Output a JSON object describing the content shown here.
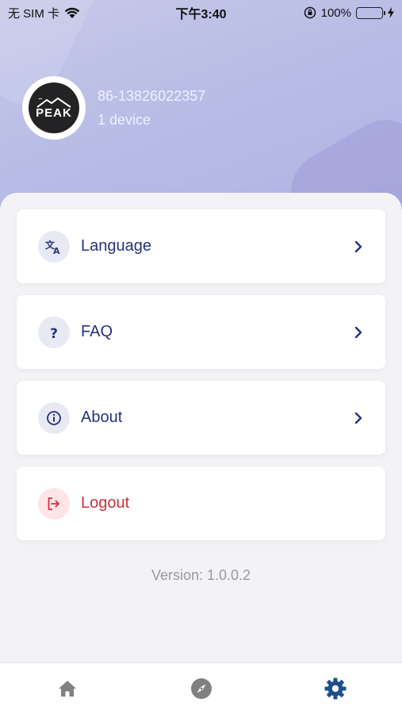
{
  "status_bar": {
    "carrier": "无 SIM 卡",
    "time": "下午3:40",
    "battery": "100%"
  },
  "profile": {
    "avatar_text": "PEAK",
    "phone": "86-13826022357",
    "devices": "1 device"
  },
  "menu": {
    "items": [
      {
        "label": "Language",
        "icon": "translate-icon"
      },
      {
        "label": "FAQ",
        "icon": "question-icon"
      },
      {
        "label": "About",
        "icon": "info-icon"
      },
      {
        "label": "Logout",
        "icon": "logout-icon"
      }
    ]
  },
  "version": "Version: 1.0.0.2",
  "tabs": [
    {
      "name": "home",
      "icon": "home-icon",
      "active": false
    },
    {
      "name": "discover",
      "icon": "compass-icon",
      "active": false
    },
    {
      "name": "settings",
      "icon": "gear-icon",
      "active": true
    }
  ],
  "colors": {
    "accent": "#1d4f8f",
    "text_primary": "#25327a",
    "logout": "#c8323c",
    "tab_inactive": "#808080"
  }
}
